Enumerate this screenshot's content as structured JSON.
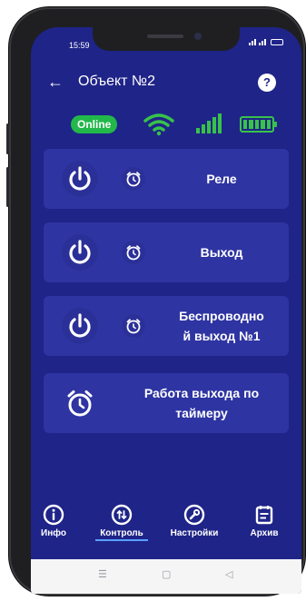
{
  "status_bar": {
    "time": "15:59"
  },
  "header": {
    "back_icon": "arrow-left-icon",
    "title": "Объект №2",
    "help_icon": "help-circle-icon",
    "help_glyph": "?"
  },
  "indicators": {
    "online_label": "Online",
    "wifi_icon": "wifi-icon",
    "signal_icon": "cellular-signal-icon",
    "battery_icon": "battery-full-icon",
    "status_color": "#37c34a"
  },
  "cards": [
    {
      "label": "Реле",
      "power_icon": "power-icon",
      "timer_icon": "alarm-clock-icon"
    },
    {
      "label": "Выход",
      "power_icon": "power-icon",
      "timer_icon": "alarm-clock-icon"
    },
    {
      "label_line1": "Беспроводно",
      "label_line2": "й выход №1",
      "power_icon": "power-icon",
      "timer_icon": "alarm-clock-icon"
    },
    {
      "label_line1": "Работа выхода по",
      "label_line2": "таймеру",
      "timer_icon": "alarm-clock-icon"
    }
  ],
  "nav": {
    "items": [
      {
        "label": "Инфо",
        "icon": "info-icon"
      },
      {
        "label": "Контроль",
        "icon": "control-icon",
        "active": true
      },
      {
        "label": "Настройки",
        "icon": "wrench-icon"
      },
      {
        "label": "Архив",
        "icon": "archive-calendar-icon"
      }
    ]
  },
  "system_nav": {
    "menu_glyph": "☰",
    "home_glyph": "▢",
    "back_glyph": "◁"
  },
  "colors": {
    "background": "#1f2488",
    "card": "#2e34a2",
    "online_badge": "#22b84a",
    "active_underline": "#5aa0ff"
  }
}
